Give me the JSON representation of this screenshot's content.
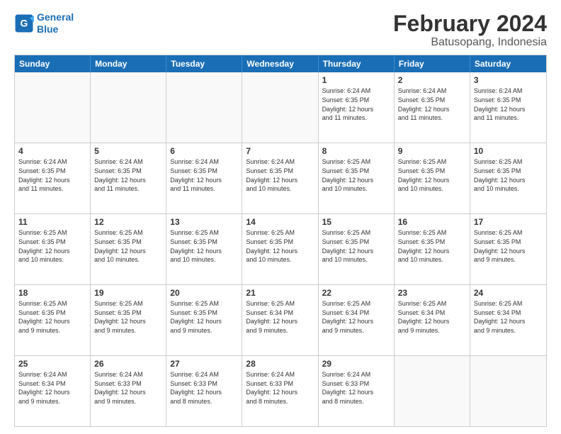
{
  "logo": {
    "line1": "General",
    "line2": "Blue"
  },
  "title": {
    "month": "February 2024",
    "location": "Batusopang, Indonesia"
  },
  "weekdays": [
    "Sunday",
    "Monday",
    "Tuesday",
    "Wednesday",
    "Thursday",
    "Friday",
    "Saturday"
  ],
  "rows": [
    [
      {
        "day": "",
        "info": ""
      },
      {
        "day": "",
        "info": ""
      },
      {
        "day": "",
        "info": ""
      },
      {
        "day": "",
        "info": ""
      },
      {
        "day": "1",
        "info": "Sunrise: 6:24 AM\nSunset: 6:35 PM\nDaylight: 12 hours\nand 11 minutes."
      },
      {
        "day": "2",
        "info": "Sunrise: 6:24 AM\nSunset: 6:35 PM\nDaylight: 12 hours\nand 11 minutes."
      },
      {
        "day": "3",
        "info": "Sunrise: 6:24 AM\nSunset: 6:35 PM\nDaylight: 12 hours\nand 11 minutes."
      }
    ],
    [
      {
        "day": "4",
        "info": "Sunrise: 6:24 AM\nSunset: 6:35 PM\nDaylight: 12 hours\nand 11 minutes."
      },
      {
        "day": "5",
        "info": "Sunrise: 6:24 AM\nSunset: 6:35 PM\nDaylight: 12 hours\nand 11 minutes."
      },
      {
        "day": "6",
        "info": "Sunrise: 6:24 AM\nSunset: 6:35 PM\nDaylight: 12 hours\nand 11 minutes."
      },
      {
        "day": "7",
        "info": "Sunrise: 6:24 AM\nSunset: 6:35 PM\nDaylight: 12 hours\nand 10 minutes."
      },
      {
        "day": "8",
        "info": "Sunrise: 6:25 AM\nSunset: 6:35 PM\nDaylight: 12 hours\nand 10 minutes."
      },
      {
        "day": "9",
        "info": "Sunrise: 6:25 AM\nSunset: 6:35 PM\nDaylight: 12 hours\nand 10 minutes."
      },
      {
        "day": "10",
        "info": "Sunrise: 6:25 AM\nSunset: 6:35 PM\nDaylight: 12 hours\nand 10 minutes."
      }
    ],
    [
      {
        "day": "11",
        "info": "Sunrise: 6:25 AM\nSunset: 6:35 PM\nDaylight: 12 hours\nand 10 minutes."
      },
      {
        "day": "12",
        "info": "Sunrise: 6:25 AM\nSunset: 6:35 PM\nDaylight: 12 hours\nand 10 minutes."
      },
      {
        "day": "13",
        "info": "Sunrise: 6:25 AM\nSunset: 6:35 PM\nDaylight: 12 hours\nand 10 minutes."
      },
      {
        "day": "14",
        "info": "Sunrise: 6:25 AM\nSunset: 6:35 PM\nDaylight: 12 hours\nand 10 minutes."
      },
      {
        "day": "15",
        "info": "Sunrise: 6:25 AM\nSunset: 6:35 PM\nDaylight: 12 hours\nand 10 minutes."
      },
      {
        "day": "16",
        "info": "Sunrise: 6:25 AM\nSunset: 6:35 PM\nDaylight: 12 hours\nand 10 minutes."
      },
      {
        "day": "17",
        "info": "Sunrise: 6:25 AM\nSunset: 6:35 PM\nDaylight: 12 hours\nand 9 minutes."
      }
    ],
    [
      {
        "day": "18",
        "info": "Sunrise: 6:25 AM\nSunset: 6:35 PM\nDaylight: 12 hours\nand 9 minutes."
      },
      {
        "day": "19",
        "info": "Sunrise: 6:25 AM\nSunset: 6:35 PM\nDaylight: 12 hours\nand 9 minutes."
      },
      {
        "day": "20",
        "info": "Sunrise: 6:25 AM\nSunset: 6:35 PM\nDaylight: 12 hours\nand 9 minutes."
      },
      {
        "day": "21",
        "info": "Sunrise: 6:25 AM\nSunset: 6:34 PM\nDaylight: 12 hours\nand 9 minutes."
      },
      {
        "day": "22",
        "info": "Sunrise: 6:25 AM\nSunset: 6:34 PM\nDaylight: 12 hours\nand 9 minutes."
      },
      {
        "day": "23",
        "info": "Sunrise: 6:25 AM\nSunset: 6:34 PM\nDaylight: 12 hours\nand 9 minutes."
      },
      {
        "day": "24",
        "info": "Sunrise: 6:25 AM\nSunset: 6:34 PM\nDaylight: 12 hours\nand 9 minutes."
      }
    ],
    [
      {
        "day": "25",
        "info": "Sunrise: 6:24 AM\nSunset: 6:34 PM\nDaylight: 12 hours\nand 9 minutes."
      },
      {
        "day": "26",
        "info": "Sunrise: 6:24 AM\nSunset: 6:33 PM\nDaylight: 12 hours\nand 9 minutes."
      },
      {
        "day": "27",
        "info": "Sunrise: 6:24 AM\nSunset: 6:33 PM\nDaylight: 12 hours\nand 8 minutes."
      },
      {
        "day": "28",
        "info": "Sunrise: 6:24 AM\nSunset: 6:33 PM\nDaylight: 12 hours\nand 8 minutes."
      },
      {
        "day": "29",
        "info": "Sunrise: 6:24 AM\nSunset: 6:33 PM\nDaylight: 12 hours\nand 8 minutes."
      },
      {
        "day": "",
        "info": ""
      },
      {
        "day": "",
        "info": ""
      }
    ]
  ]
}
